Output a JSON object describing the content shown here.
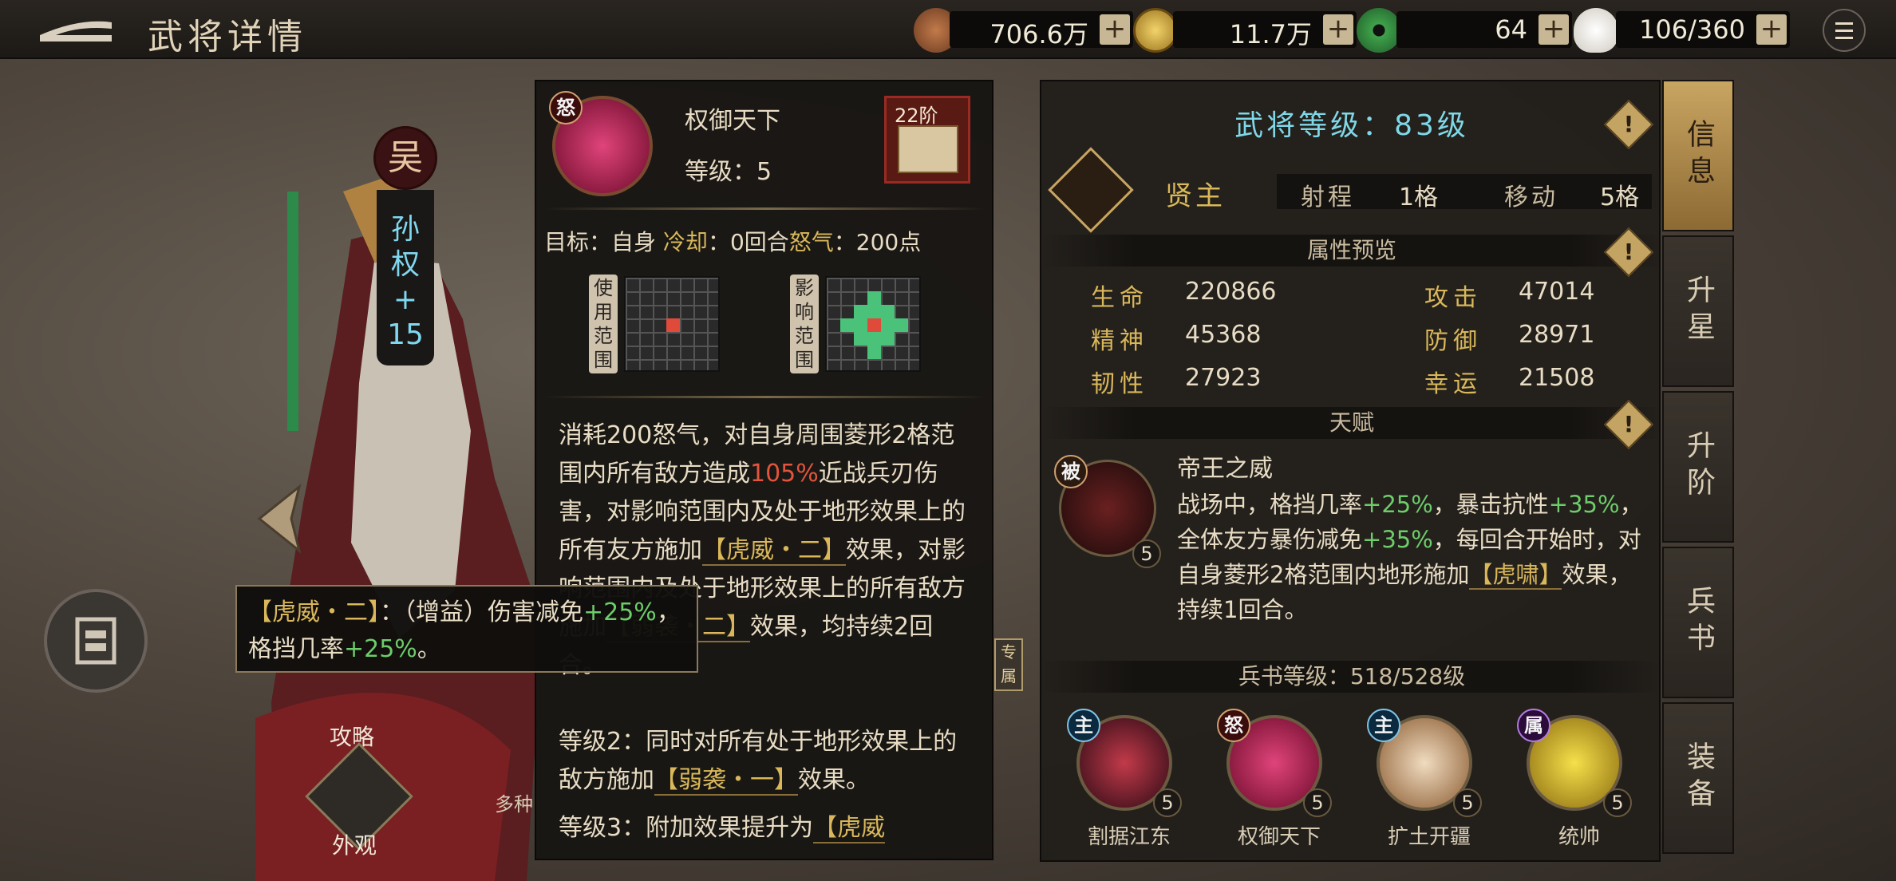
{
  "header": {
    "title": "武将详情"
  },
  "resources": [
    {
      "icon": "copper-coins-icon",
      "value": "706.6万"
    },
    {
      "icon": "gold-coin-icon",
      "value": "11.7万"
    },
    {
      "icon": "jade-coin-icon",
      "value": "64"
    },
    {
      "icon": "steamed-bun-icon",
      "value": "106/360"
    }
  ],
  "plus_label": "+",
  "hero": {
    "faction": "吴",
    "name": "孙权+15",
    "name_chars": [
      "孙",
      "权",
      "+",
      "15"
    ],
    "left_menu": {
      "strategy": "攻略",
      "appearance": "外观"
    },
    "bg_partial_text": "多种",
    "exclusive_label": "专属"
  },
  "skill_popup": {
    "tag": "怒",
    "name": "权御天下",
    "level_label": "等级：5",
    "tier": "22阶",
    "meta": {
      "target": "目标：自身",
      "cooldown_label": "冷却",
      "cooldown": "：0回合",
      "rage_label": "怒气",
      "rage": "：200点"
    },
    "range_use_label": "使用范围",
    "range_effect_label": "影响范围",
    "desc": {
      "p1": "消耗200怒气，对自身周围菱形2格范围内所有敌方造成",
      "p1_hl": "105%",
      "p2": "近战兵刃伤害，对影响范围内及处于地形效果上的所有友方施加",
      "p2_b": "【虎威・二】",
      "p3": "效果，对影响范围内及处于地形效果上的所有敌方施加",
      "p3_b": "【弱袭・二】",
      "p4": "效果，均持续2回合。",
      "lv2": "等级2：同时对所有处于地形效果上的敌方施加",
      "lv2_b": "【弱袭・一】",
      "lv2_end": "效果。",
      "lv3": "等级3：附加效果提升为",
      "lv3_b": "【虎威"
    }
  },
  "tooltip": {
    "name": "【虎威・二】",
    "colon": "：（增益）伤害减免",
    "v1": "+25%",
    "mid": "，格挡几率",
    "v2": "+25%",
    "end": "。"
  },
  "info": {
    "level_title": "武将等级：83级",
    "class_name": "贤主",
    "range_label": "射程",
    "range_value": "1格",
    "move_label": "移动",
    "move_value": "5格",
    "attr_header": "属性预览",
    "attrs": [
      {
        "label": "生命",
        "value": "220866"
      },
      {
        "label": "攻击",
        "value": "47014"
      },
      {
        "label": "精神",
        "value": "45368"
      },
      {
        "label": "防御",
        "value": "28971"
      },
      {
        "label": "韧性",
        "value": "27923"
      },
      {
        "label": "幸运",
        "value": "21508"
      }
    ],
    "talent_header": "天赋",
    "talent": {
      "tag": "被",
      "name": "帝王之威",
      "level": "5",
      "t1": "战场中，格挡几率",
      "t1_v": "+25%",
      "t2": "，暴击抗性",
      "t2_v": "+35%",
      "t3": "，全体友方暴伤减免",
      "t3_v": "+35%",
      "t4": "，每回合开始时，对自身菱形2格范围内地形施加",
      "t4_b": "【虎啸】",
      "t5": "效果，持续1回合。"
    },
    "book_header": "兵书等级：518/528级",
    "skills": [
      {
        "tag": "主",
        "name": "割据江东",
        "level": "5"
      },
      {
        "tag": "怒",
        "name": "权御天下",
        "level": "5"
      },
      {
        "tag": "主",
        "name": "扩土开疆",
        "level": "5"
      },
      {
        "tag": "属",
        "name": "统帅",
        "level": "5"
      }
    ]
  },
  "tabs": [
    "信息",
    "升星",
    "升阶",
    "兵书",
    "装备"
  ]
}
